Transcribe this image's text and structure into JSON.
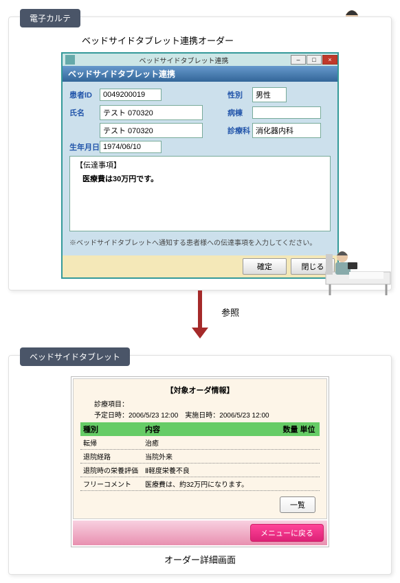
{
  "top": {
    "tag": "電子カルテ",
    "title": "ベッドサイドタブレット連携オーダー",
    "window": {
      "titlebar": "ベッドサイドタブレット連携",
      "subtitle": "ベッドサイドタブレット連携",
      "patient_id_label": "患者ID",
      "patient_id": "0049200019",
      "name_label": "氏名",
      "name": "テスト 070320",
      "birth_label": "生年月日",
      "birth": "1974/06/10",
      "sex_label": "性別",
      "sex": "男性",
      "ward_label": "病棟",
      "ward": "",
      "dept_label": "診療科",
      "dept": "消化器内科",
      "memo_heading": "【伝達事項】",
      "memo_body": "医療費は30万円です。",
      "memo_note": "※ベッドサイドタブレットへ通知する患者様への伝達事項を入力してください。",
      "confirm": "確定",
      "close": "閉じる"
    }
  },
  "arrow_label": "参照",
  "bottom": {
    "tag": "ベッドサイドタブレット",
    "section": "【対象オーダ情報】",
    "meta1": "診療項目：",
    "meta2": "予定日時：2006/5/23 12:00　実施日時：2006/5/23 12:00",
    "headers": {
      "a": "種別",
      "b": "内容",
      "c": "数量 単位"
    },
    "rows": [
      {
        "a": "転帰",
        "b": "治癒",
        "c": ""
      },
      {
        "a": "退院経路",
        "b": "当院外来",
        "c": ""
      },
      {
        "a": "退院時の栄養評価",
        "b": "Ⅱ軽度栄養不良",
        "c": ""
      },
      {
        "a": "フリーコメント",
        "b": "医療費は、約32万円になります。",
        "c": ""
      }
    ],
    "btn_list": "一覧",
    "btn_menu": "メニューに戻る",
    "caption": "オーダー詳細画面"
  }
}
